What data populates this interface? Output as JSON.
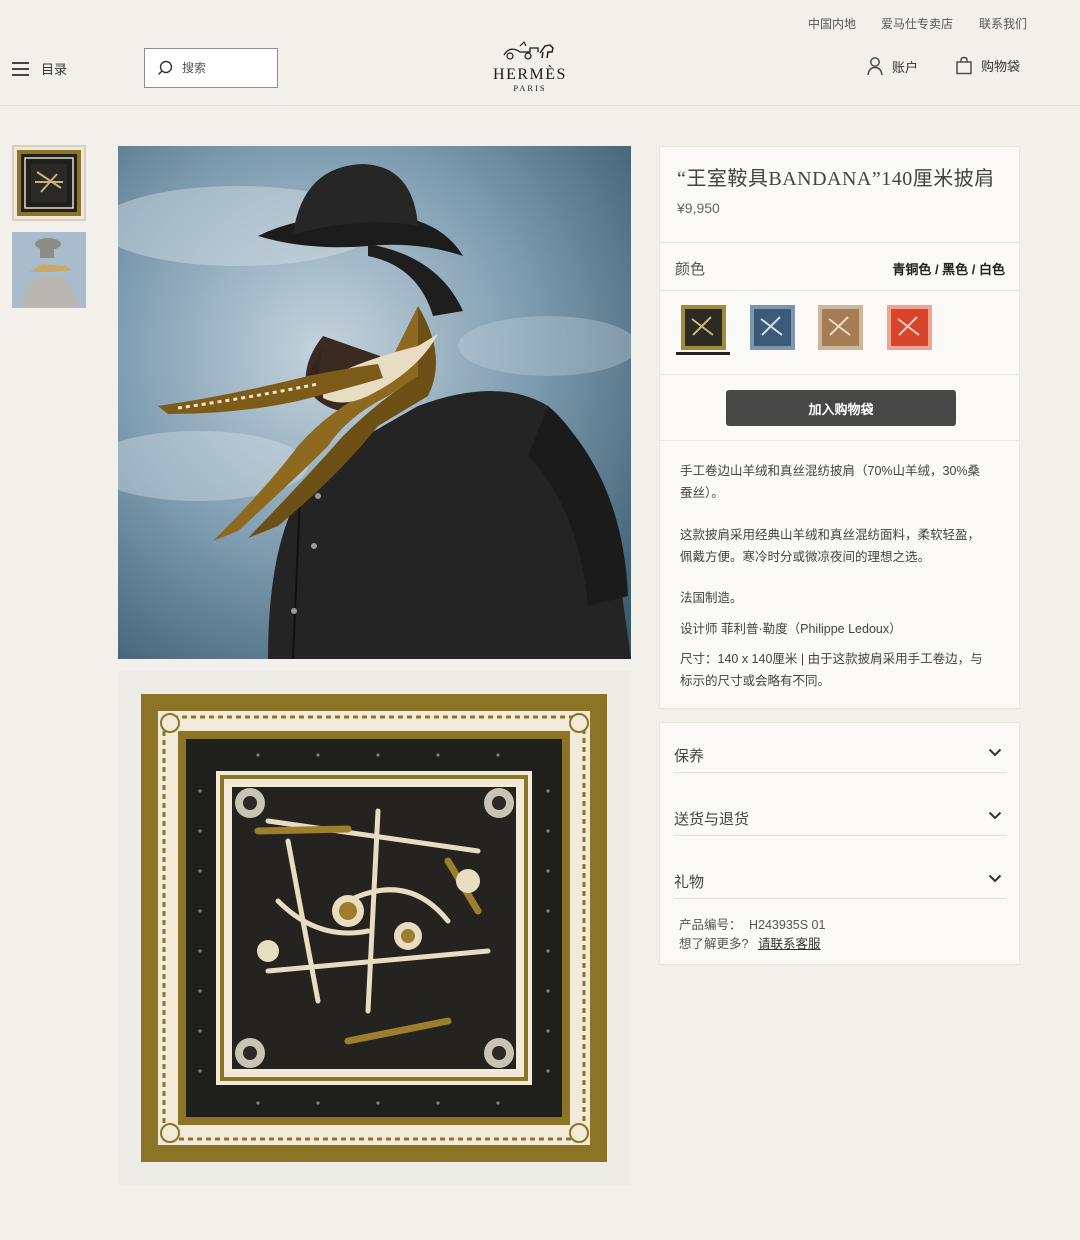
{
  "utility": {
    "links": [
      "中国内地",
      "爱马仕专卖店",
      "联系我们"
    ]
  },
  "header": {
    "menu_label": "目录",
    "search_placeholder": "搜索",
    "logo_word": "HERMÈS",
    "logo_city": "PARIS",
    "account_label": "账户",
    "bag_label": "购物袋"
  },
  "product": {
    "title": "“王室鞍具BANDANA”140厘米披肩",
    "price": "¥9,950",
    "color_label": "颜色",
    "color_value": "青铜色 / 黑色 / 白色",
    "swatches": [
      {
        "name": "青铜色 / 黑色 / 白色",
        "color": "#2b2a24",
        "border": "#a08b3a",
        "selected": true
      },
      {
        "name": "blue",
        "color": "#3b5a78",
        "border": "#7e96ad",
        "selected": false
      },
      {
        "name": "camel",
        "color": "#a57c56",
        "border": "#cdb79a",
        "selected": false
      },
      {
        "name": "orange",
        "color": "#d9452a",
        "border": "#f0a48f",
        "selected": false
      }
    ],
    "add_to_bag": "加入购物袋",
    "desc_1": [
      "手工卷边山羊绒和真丝混纺披肩（70%山羊绒，30%桑",
      "蚕丝）。"
    ],
    "desc_2": [
      "这款披肩采用经典山羊绒和真丝混纺面料，柔软轻盈，",
      "佩戴方便。寒冷时分或微凉夜间的理想之选。"
    ],
    "made_in": "法国制造。",
    "designer": "设计师 菲利普·勒度（Philippe Ledoux）",
    "size": [
      "尺寸：140 x 140厘米 | 由于这款披肩采用手工卷边，与",
      "标示的尺寸或会略有不同。"
    ]
  },
  "accordion": {
    "items": [
      "保养",
      "送货与退货",
      "礼物"
    ],
    "product_code_label": "产品编号：",
    "product_code": "H243935S 01",
    "more_label": "想了解更多?",
    "contact_link": "请联系客服"
  },
  "colors": {
    "accent_gold": "#8c7426",
    "scarf_black": "#1f1f1c",
    "button": "#474747"
  }
}
